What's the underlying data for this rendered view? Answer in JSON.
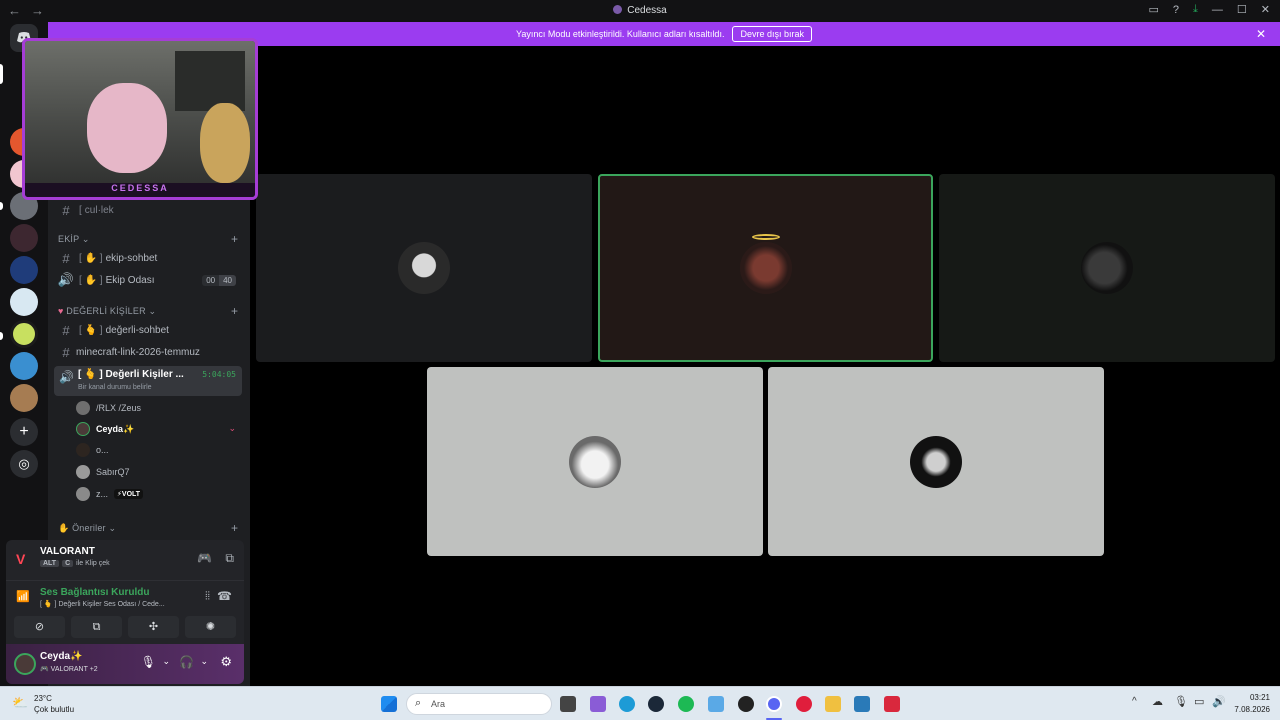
{
  "window": {
    "title": "Cedessa",
    "nav_back": "←",
    "nav_forward": "→",
    "controls": {
      "inbox": "▭",
      "help": "?",
      "download": "⤓",
      "minimize": "—",
      "maximize": "☐",
      "close": "✕"
    }
  },
  "banner": {
    "text": "Yayıncı Modu etkinleştirildi. Kullanıcı adları kısaltıldı.",
    "button": "Devre dışı bırak",
    "close": "✕"
  },
  "overlay": {
    "label": "CEDESSA"
  },
  "sidebar": {
    "top_channel": {
      "prefix": "[",
      "name": "cul·lek",
      "suffix": "]"
    },
    "categories": [
      {
        "name": "EKİP",
        "chevron": "⌄"
      },
      {
        "name": "DEĞERLİ KİŞİLER",
        "chevron": "⌄"
      },
      {
        "name": "Öneriler",
        "chevron": "⌄"
      }
    ],
    "channels": [
      {
        "name": "ekip-sohbet",
        "type": "text"
      },
      {
        "name": "Ekip Odası",
        "type": "voice",
        "badge_a": "00",
        "badge_b": "40"
      },
      {
        "name": "değerli-sohbet",
        "type": "text"
      },
      {
        "name": "minecraft-link-2026-temmuz",
        "type": "text"
      }
    ],
    "active_voice": {
      "name": "Değerli Kişiler ...",
      "timer": "5:04:05",
      "status": "Bir kanal durumu belirle"
    },
    "voice_users": [
      {
        "name": "/RLX /Zeus"
      },
      {
        "name": "Ceyda✨"
      },
      {
        "name": "o..."
      },
      {
        "name": "SabırQ7"
      },
      {
        "name": "z...",
        "tag": "⚡VOLT"
      }
    ]
  },
  "activity_panel": {
    "game": "VALORANT",
    "hint_key1": "ALT",
    "hint_key2": "C",
    "hint_text": "ile Klip çek"
  },
  "voice_panel": {
    "status": "Ses Bağlantısı Kuruldu",
    "channel": "[ 🫰 ] Değerli Kişiler Ses Odası / Cede..."
  },
  "user_panel": {
    "username": "Ceyda✨",
    "activity": "VALORANT +2"
  },
  "stage": {
    "tiles": [
      {
        "name": "tile-1"
      },
      {
        "name": "tile-2-speaking"
      },
      {
        "name": "tile-3"
      },
      {
        "name": "tile-4"
      },
      {
        "name": "tile-5"
      }
    ]
  },
  "taskbar": {
    "weather_temp": "23°C",
    "weather_desc": "Çok bulutlu",
    "search_placeholder": "Ara",
    "time": "03:21",
    "date": "7.08.2026"
  },
  "colors": {
    "brand_purple": "#9b3cf0",
    "speaking_green": "#3ba55c",
    "bg_dark": "#1e1f22"
  }
}
